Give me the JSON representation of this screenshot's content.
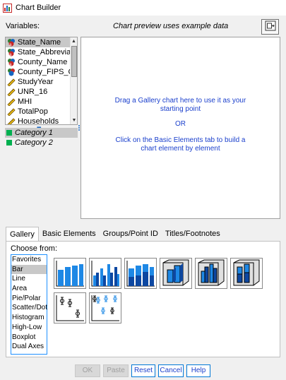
{
  "window": {
    "title": "Chart Builder"
  },
  "variables_label": "Variables:",
  "preview_note": "Chart preview uses example data",
  "variables": [
    {
      "label": "State_Name",
      "icon": "nominal-text-icon",
      "selected": true
    },
    {
      "label": "State_Abbreviat...",
      "icon": "nominal-text-icon",
      "selected": false
    },
    {
      "label": "County_Name",
      "icon": "nominal-text-icon",
      "selected": false
    },
    {
      "label": "County_FIPS_C...",
      "icon": "nominal-numeric-icon",
      "selected": false
    },
    {
      "label": "StudyYear",
      "icon": "scale-icon",
      "selected": false
    },
    {
      "label": "UNR_16",
      "icon": "scale-icon",
      "selected": false
    },
    {
      "label": "MHI",
      "icon": "scale-icon",
      "selected": false
    },
    {
      "label": "TotalPop",
      "icon": "scale-icon",
      "selected": false
    },
    {
      "label": "Households",
      "icon": "scale-icon",
      "selected": false
    }
  ],
  "categories": [
    {
      "label": "Category 1",
      "selected": true
    },
    {
      "label": "Category 2",
      "selected": false
    }
  ],
  "canvas": {
    "line1": "Drag a Gallery chart here to use it as your",
    "line2": "starting point",
    "line3": "OR",
    "line4": "Click on the Basic Elements tab to build a",
    "line5": "chart element by element"
  },
  "tabs": [
    {
      "label": "Gallery",
      "active": true
    },
    {
      "label": "Basic Elements",
      "active": false
    },
    {
      "label": "Groups/Point ID",
      "active": false
    },
    {
      "label": "Titles/Footnotes",
      "active": false
    }
  ],
  "choose_from_label": "Choose from:",
  "chart_types": [
    {
      "label": "Favorites",
      "selected": false
    },
    {
      "label": "Bar",
      "selected": true
    },
    {
      "label": "Line",
      "selected": false
    },
    {
      "label": "Area",
      "selected": false
    },
    {
      "label": "Pie/Polar",
      "selected": false
    },
    {
      "label": "Scatter/Dot",
      "selected": false
    },
    {
      "label": "Histogram",
      "selected": false
    },
    {
      "label": "High-Low",
      "selected": false
    },
    {
      "label": "Boxplot",
      "selected": false
    },
    {
      "label": "Dual Axes",
      "selected": false
    }
  ],
  "gallery_thumbnails": [
    "simple-bar-icon",
    "clustered-bar-icon",
    "stacked-bar-icon",
    "simple-3d-bar-icon",
    "clustered-3d-bar-icon",
    "stacked-3d-bar-icon",
    "simple-error-bar-icon",
    "clustered-error-bar-icon"
  ],
  "buttons": {
    "ok": "OK",
    "paste": "Paste",
    "reset": "Reset",
    "cancel": "Cancel",
    "help": "Help"
  },
  "colors": {
    "accent_blue": "#1a3fcc",
    "bar_blue": "#1e88e5",
    "bar_dark": "#0d47a1",
    "category_green": "#00b050"
  }
}
